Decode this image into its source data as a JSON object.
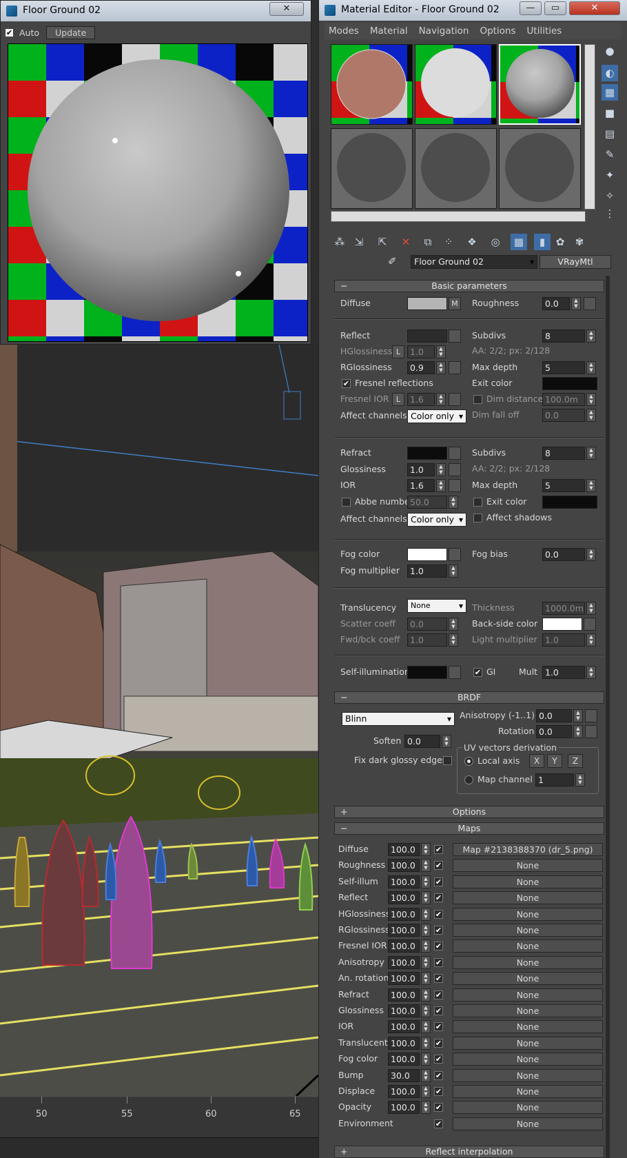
{
  "preview": {
    "title": "Floor Ground 02",
    "close": "✕",
    "auto_label": "Auto",
    "auto_checked": true,
    "update_label": "Update"
  },
  "viewport": {
    "ruler_ticks": [
      "50",
      "55",
      "60",
      "65"
    ]
  },
  "editor": {
    "title": "Material Editor - Floor Ground 02",
    "window_buttons": [
      "—",
      "▭",
      "✕"
    ],
    "menu": [
      "Modes",
      "Material",
      "Navigation",
      "Options",
      "Utilities"
    ],
    "material_name": "Floor Ground 02",
    "material_type": "VRayMtl",
    "basic": {
      "header": "Basic parameters",
      "diffuse_label": "Diffuse",
      "diffuse_map_btn": "M",
      "roughness_label": "Roughness",
      "roughness": "0.0",
      "reflect_label": "Reflect",
      "hglossiness_label": "HGlossiness",
      "hglossiness": "1.0",
      "lock_label": "L",
      "rglossiness_label": "RGlossiness",
      "rglossiness": "0.9",
      "fresnel_label": "Fresnel reflections",
      "fresnel_ior_label": "Fresnel IOR",
      "fresnel_ior": "1.6",
      "affect_channels_label": "Affect channels",
      "affect_channels": "Color only",
      "subdivs_label": "Subdivs",
      "subdivs": "8",
      "aa_text": "AA: 2/2; px: 2/128",
      "max_depth_label": "Max depth",
      "max_depth": "5",
      "exit_color_label": "Exit color",
      "dim_distance_label": "Dim distance",
      "dim_distance": "100.0m",
      "dim_falloff_label": "Dim fall off",
      "dim_falloff": "0.0",
      "refract_label": "Refract",
      "glossiness_label": "Glossiness",
      "glossiness": "1.0",
      "ior_label": "IOR",
      "ior": "1.6",
      "abbe_label": "Abbe number",
      "abbe": "50.0",
      "r_subdivs": "8",
      "r_aa_text": "AA: 2/2; px: 2/128",
      "r_max_depth": "5",
      "affect_shadows_label": "Affect shadows",
      "fog_color_label": "Fog color",
      "fog_multiplier_label": "Fog multiplier",
      "fog_multiplier": "1.0",
      "fog_bias_label": "Fog bias",
      "fog_bias": "0.0",
      "translucency_label": "Translucency",
      "translucency": "None",
      "scatter_label": "Scatter coeff",
      "scatter": "0.0",
      "fwd_label": "Fwd/bck coeff",
      "fwd": "1.0",
      "thickness_label": "Thickness",
      "thickness": "1000.0m",
      "backside_label": "Back-side color",
      "light_mult_label": "Light multiplier",
      "light_mult": "1.0",
      "self_illum_label": "Self-illumination",
      "gi_label": "GI",
      "mult_label": "Mult",
      "mult": "1.0"
    },
    "brdf": {
      "header": "BRDF",
      "type": "Blinn",
      "anisotropy_label": "Anisotropy (-1..1)",
      "anisotropy": "0.0",
      "rotation_label": "Rotation",
      "rotation": "0.0",
      "soften_label": "Soften",
      "soften": "0.0",
      "fix_label": "Fix dark glossy edges",
      "uv_label": "UV vectors derivation",
      "local_axis_label": "Local axis",
      "axes": [
        "X",
        "Y",
        "Z"
      ],
      "map_channel_label": "Map channel",
      "map_channel": "1"
    },
    "options_header": "Options",
    "maps_header": "Maps",
    "maps": [
      {
        "name": "Diffuse",
        "amount": "100.0",
        "map": "Map #2138388370 (dr_5.png)"
      },
      {
        "name": "Roughness",
        "amount": "100.0",
        "map": "None"
      },
      {
        "name": "Self-illum",
        "amount": "100.0",
        "map": "None"
      },
      {
        "name": "Reflect",
        "amount": "100.0",
        "map": "None"
      },
      {
        "name": "HGlossiness",
        "amount": "100.0",
        "map": "None"
      },
      {
        "name": "RGlossiness",
        "amount": "100.0",
        "map": "None"
      },
      {
        "name": "Fresnel IOR",
        "amount": "100.0",
        "map": "None"
      },
      {
        "name": "Anisotropy",
        "amount": "100.0",
        "map": "None"
      },
      {
        "name": "An. rotation",
        "amount": "100.0",
        "map": "None"
      },
      {
        "name": "Refract",
        "amount": "100.0",
        "map": "None"
      },
      {
        "name": "Glossiness",
        "amount": "100.0",
        "map": "None"
      },
      {
        "name": "IOR",
        "amount": "100.0",
        "map": "None"
      },
      {
        "name": "Translucent",
        "amount": "100.0",
        "map": "None"
      },
      {
        "name": "Fog color",
        "amount": "100.0",
        "map": "None"
      },
      {
        "name": "Bump",
        "amount": "30.0",
        "map": "None"
      },
      {
        "name": "Displace",
        "amount": "100.0",
        "map": "None"
      },
      {
        "name": "Opacity",
        "amount": "100.0",
        "map": "None"
      },
      {
        "name": "Environment",
        "amount": "",
        "map": "None"
      }
    ],
    "next_header": "Reflect interpolation"
  }
}
